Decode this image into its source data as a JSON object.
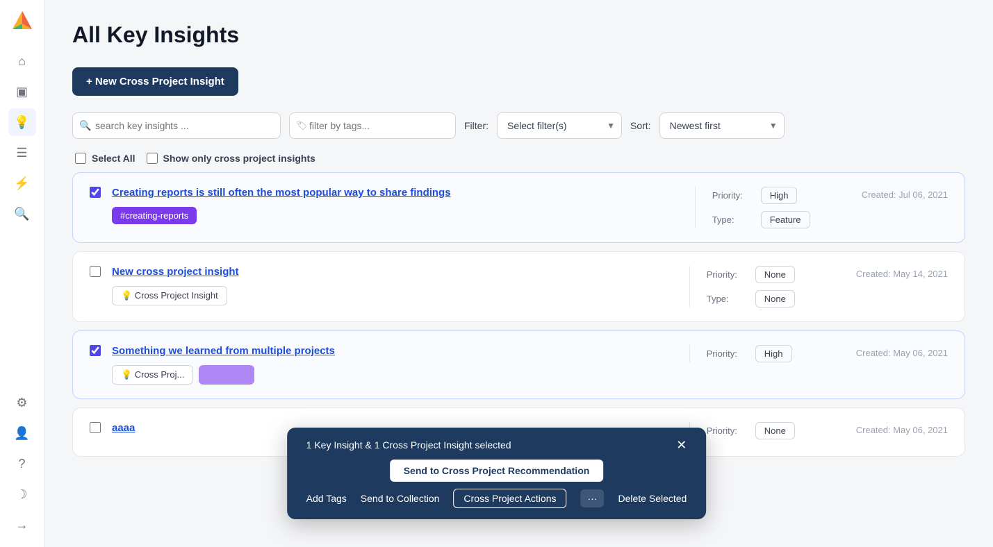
{
  "page": {
    "title": "All Key Insights"
  },
  "sidebar": {
    "items": [
      {
        "name": "home",
        "icon": "⌂",
        "active": false
      },
      {
        "name": "layout",
        "icon": "▣",
        "active": false
      },
      {
        "name": "insights",
        "icon": "💡",
        "active": true
      },
      {
        "name": "document",
        "icon": "☰",
        "active": false
      },
      {
        "name": "lightning",
        "icon": "⚡",
        "active": false
      },
      {
        "name": "search",
        "icon": "🔍",
        "active": false
      }
    ],
    "bottom_items": [
      {
        "name": "settings",
        "icon": "⚙"
      },
      {
        "name": "person",
        "icon": "👤"
      },
      {
        "name": "help",
        "icon": "?"
      },
      {
        "name": "moon",
        "icon": "☽"
      },
      {
        "name": "logout",
        "icon": "→"
      }
    ]
  },
  "toolbar": {
    "new_button_label": "+ New Cross Project Insight",
    "search_placeholder": "search key insights ...",
    "tag_placeholder": "filter by tags...",
    "filter_label": "Filter:",
    "filter_placeholder": "Select filter(s)",
    "sort_label": "Sort:",
    "sort_value": "Newest first"
  },
  "select_all": {
    "label": "Select All",
    "cross_project_label": "Show only cross project insights"
  },
  "insights": [
    {
      "id": 1,
      "checked": true,
      "title": "Creating reports is still often the most popular way to share findings",
      "tags": [
        {
          "label": "#creating-reports",
          "type": "purple"
        }
      ],
      "priority": "High",
      "type": "Feature",
      "created": "Created: Jul 06, 2021"
    },
    {
      "id": 2,
      "checked": false,
      "title": "New cross project insight",
      "tags": [
        {
          "label": "Cross Project Insight",
          "type": "outlined",
          "icon": "💡"
        }
      ],
      "priority": "None",
      "type": "None",
      "created": "Created: May 14, 2021"
    },
    {
      "id": 3,
      "checked": true,
      "title": "Something we learned from multiple projects",
      "tags": [
        {
          "label": "Cross Proj...",
          "type": "outlined",
          "icon": "💡"
        },
        {
          "label": "",
          "type": "purple-partial"
        }
      ],
      "priority": "High",
      "type": "",
      "created": "Created: May 06, 2021"
    },
    {
      "id": 4,
      "checked": false,
      "title": "aaaa",
      "tags": [],
      "priority": "None",
      "type": "",
      "created": "Created: May 06, 2021"
    }
  ],
  "bulk_bar": {
    "selected_label": "1 Key Insight & 1 Cross Project Insight selected",
    "send_to_cpr_label": "Send to Cross Project Recommendation",
    "add_tags_label": "Add Tags",
    "send_to_collection_label": "Send to Collection",
    "cross_project_actions_label": "Cross Project Actions",
    "delete_label": "Delete Selected",
    "more_icon": "···"
  }
}
